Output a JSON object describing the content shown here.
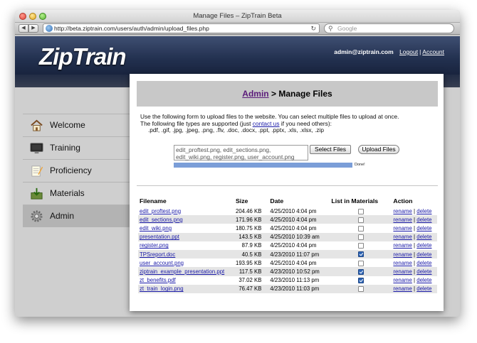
{
  "window": {
    "title": "Manage Files – ZipTrain Beta"
  },
  "browser": {
    "url": "http://beta.ziptrain.com/users/auth/admin/upload_files.php",
    "search_placeholder": "Google"
  },
  "header": {
    "logo": "ZipTrain",
    "user_email": "admin@ziptrain.com",
    "logout": "Logout",
    "separator": "|",
    "account": "Account"
  },
  "sidebar": {
    "items": [
      {
        "label": "Welcome",
        "icon": "house-icon"
      },
      {
        "label": "Training",
        "icon": "monitor-icon"
      },
      {
        "label": "Proficiency",
        "icon": "notepad-icon"
      },
      {
        "label": "Materials",
        "icon": "download-box-icon"
      },
      {
        "label": "Admin",
        "icon": "gear-icon",
        "active": true
      }
    ]
  },
  "page": {
    "breadcrumb_link": "Admin",
    "breadcrumb_rest": " > Manage Files",
    "intro_line1": "Use the following form to upload files to the website. You can select multiple files to upload at once.",
    "intro_line2_pre": "The following file types are supported (just ",
    "intro_link": "contact us",
    "intro_line2_post": " if you need others):",
    "file_types": ".pdf, .gif, .jpg, .jpeg, .png, .flv, .doc, .docx, .ppt, .pptx, .xls, .xlsx, .zip"
  },
  "upload": {
    "selected_files": "edit_proftest.png, edit_sections.png, edit_wiki.png, register.png, user_account.png",
    "select_button": "Select Files",
    "upload_button": "Upload Files",
    "progress": 1.0,
    "status": "Done!"
  },
  "table": {
    "headers": [
      "Filename",
      "Size",
      "Date",
      "List in Materials",
      "Action"
    ],
    "rename": "rename",
    "delete": "delete",
    "separator": "|",
    "rows": [
      {
        "filename": "edit_proftest.png",
        "size": "204.46 KB",
        "date": "4/25/2010 4:04 pm",
        "listed": false
      },
      {
        "filename": "edit_sections.png",
        "size": "171.96 KB",
        "date": "4/25/2010 4:04 pm",
        "listed": false
      },
      {
        "filename": "edit_wiki.png",
        "size": "180.75 KB",
        "date": "4/25/2010 4:04 pm",
        "listed": false
      },
      {
        "filename": "presentation.ppt",
        "size": "143.5 KB",
        "date": "4/25/2010 10:39 am",
        "listed": false
      },
      {
        "filename": "register.png",
        "size": "87.9 KB",
        "date": "4/25/2010 4:04 pm",
        "listed": false
      },
      {
        "filename": "TPSreport.doc",
        "size": "40.5 KB",
        "date": "4/23/2010 11:07 pm",
        "listed": true
      },
      {
        "filename": "user_account.png",
        "size": "193.95 KB",
        "date": "4/25/2010 4:04 pm",
        "listed": false
      },
      {
        "filename": "ziptrain_example_presentation.ppt",
        "size": "117.5 KB",
        "date": "4/23/2010 10:52 pm",
        "listed": true
      },
      {
        "filename": "zt_benefits.pdf",
        "size": "37.02 KB",
        "date": "4/23/2010 11:13 pm",
        "listed": true
      },
      {
        "filename": "zt_train_login.png",
        "size": "76.47 KB",
        "date": "4/23/2010 11:03 pm",
        "listed": false
      }
    ]
  }
}
